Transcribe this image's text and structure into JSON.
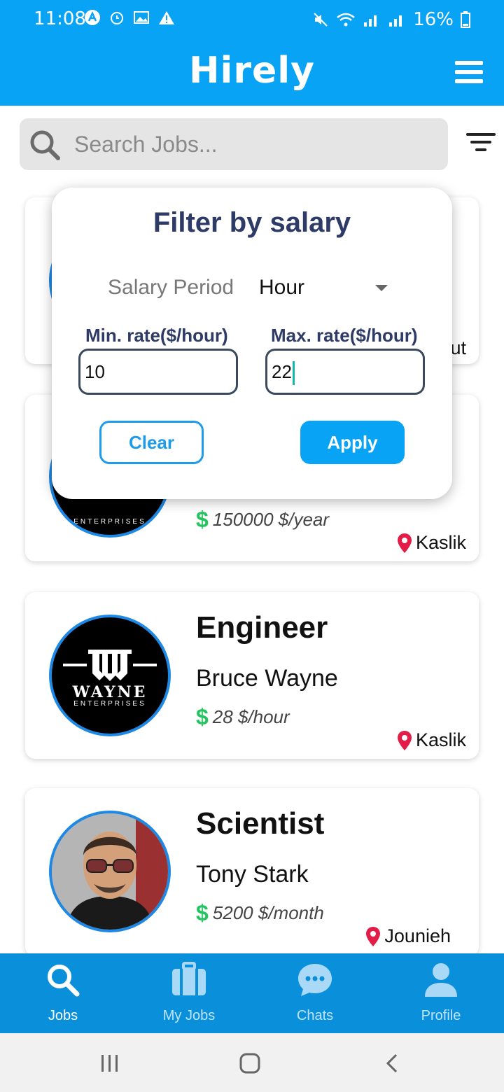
{
  "status_bar": {
    "time": "11:08",
    "battery": "16%"
  },
  "header": {
    "title": "Hirely"
  },
  "search": {
    "placeholder": "Search Jobs..."
  },
  "jobs": [
    {
      "title": "",
      "employer": "",
      "salary": "",
      "location": "ut"
    },
    {
      "title": "",
      "employer": "",
      "salary": "150000 $/year",
      "location": "Kaslik",
      "logo_text": "ENTERPRISES"
    },
    {
      "title": "Engineer",
      "employer": "Bruce Wayne",
      "salary": "28 $/hour",
      "location": "Kaslik",
      "logo_text": "WAYNE",
      "logo_sub": "ENTERPRISES"
    },
    {
      "title": "Scientist",
      "employer": "Tony Stark",
      "salary": "5200 $/month",
      "location": "Jounieh"
    }
  ],
  "filter": {
    "title": "Filter by salary",
    "period_label": "Salary Period",
    "period_value": "Hour",
    "min_label": "Min. rate($/hour)",
    "max_label": "Max. rate($/hour)",
    "min_value": "10",
    "max_value": "22",
    "clear_label": "Clear",
    "apply_label": "Apply"
  },
  "bottom_nav": [
    {
      "label": "Jobs",
      "active": true
    },
    {
      "label": "My Jobs"
    },
    {
      "label": "Chats"
    },
    {
      "label": "Profile"
    }
  ],
  "colors": {
    "primary": "#08a3f5",
    "nav": "#0a8fdb",
    "title_text": "#2e3b66",
    "salary_dollar": "#22c55e",
    "location_pin": "#e11d48"
  }
}
